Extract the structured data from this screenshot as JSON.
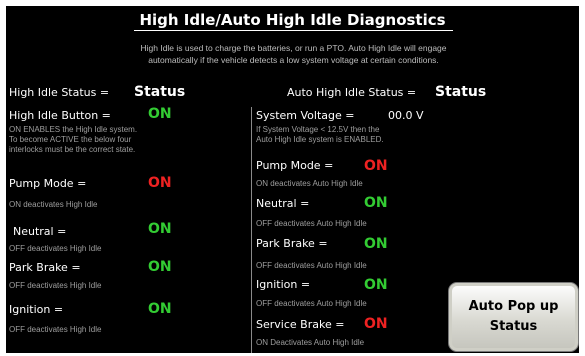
{
  "title": "High Idle/Auto High Idle Diagnostics",
  "description": {
    "line1": "High Idle is used to charge the batteries, or run a PTO.  Auto High Idle will engage",
    "line2": "automatically if the vehicle detects a low system voltage at certain conditions."
  },
  "left": {
    "status_label": "High Idle Status =",
    "status_value": "Status",
    "button_label": "High Idle Button =",
    "button_value": "ON",
    "button_note": [
      "ON ENABLES the High Idle system.",
      "To become ACTIVE the below four",
      "interlocks must be the correct state."
    ],
    "pump_label": "Pump Mode =",
    "pump_value": "ON",
    "pump_note": "ON deactivates High Idle",
    "neutral_label": "Neutral =",
    "neutral_value": "ON",
    "neutral_note": "OFF deactivates High Idle",
    "park_label": "Park Brake =",
    "park_value": "ON",
    "park_note": "OFF deactivates High Idle",
    "ignition_label": "Ignition =",
    "ignition_value": "ON",
    "ignition_note": "OFF deactivates High Idle"
  },
  "right": {
    "status_label": "Auto High Idle Status =",
    "status_value": "Status",
    "voltage_label": "System Voltage =",
    "voltage_value": "00.0 V",
    "voltage_note": [
      "If System Voltage < 12.5V  then the",
      "Auto High Idle system is ENABLED."
    ],
    "pump_label": "Pump Mode =",
    "pump_value": "ON",
    "pump_note": "ON deactivates Auto High Idle",
    "neutral_label": "Neutral =",
    "neutral_value": "ON",
    "neutral_note": "OFF deactivates Auto High Idle",
    "park_label": "Park Brake =",
    "park_value": "ON",
    "park_note": "OFF deactivates Auto High Idle",
    "ignition_label": "Ignition =",
    "ignition_value": "ON",
    "ignition_note": "OFF deactivates Auto High Idle",
    "service_label": "Service Brake =",
    "service_value": "ON",
    "service_note": "ON Deactivates Auto High Idle"
  },
  "popup_button": {
    "line1": "Auto Pop up",
    "line2": "Status"
  },
  "colors": {
    "background": "#000000",
    "on_green": "#33cc33",
    "on_red": "#ee2222",
    "note_gray": "#9e9e9e"
  }
}
